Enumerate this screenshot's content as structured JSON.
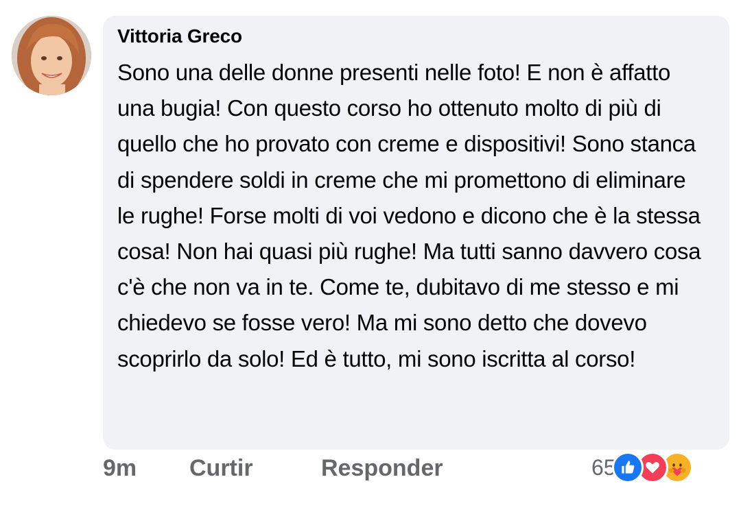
{
  "comment": {
    "author": "Vittoria Greco",
    "text": "Sono una delle donne presenti nelle foto! E non è affatto una bugia! Con questo corso ho ottenuto molto di più di quello che ho provato con creme e dispositivi! Sono stanca di spendere soldi in creme che mi promettono di eliminare le rughe! Forse molti di voi vedono e dicono che è la stessa cosa! Non hai quasi più rughe! Ma tutti sanno davvero cosa c'è che non va in te. Come te, dubitavo di me stesso e mi chiedevo se fosse vero! Ma mi sono detto che dovevo scoprirlo da solo! Ed è tutto, mi sono iscritta al corso!"
  },
  "actions": {
    "timestamp": "9m",
    "like_label": "Curtir",
    "reply_label": "Responder"
  },
  "reactions": {
    "count": "65",
    "icons": [
      "like-icon",
      "love-icon",
      "care-icon"
    ]
  },
  "colors": {
    "bubble_bg": "#f0f2f5",
    "text": "#050505",
    "secondary_text": "#65676b",
    "like_blue": "#1877f2",
    "love_red": "#f33e58",
    "care_yellow": "#f7b125"
  }
}
